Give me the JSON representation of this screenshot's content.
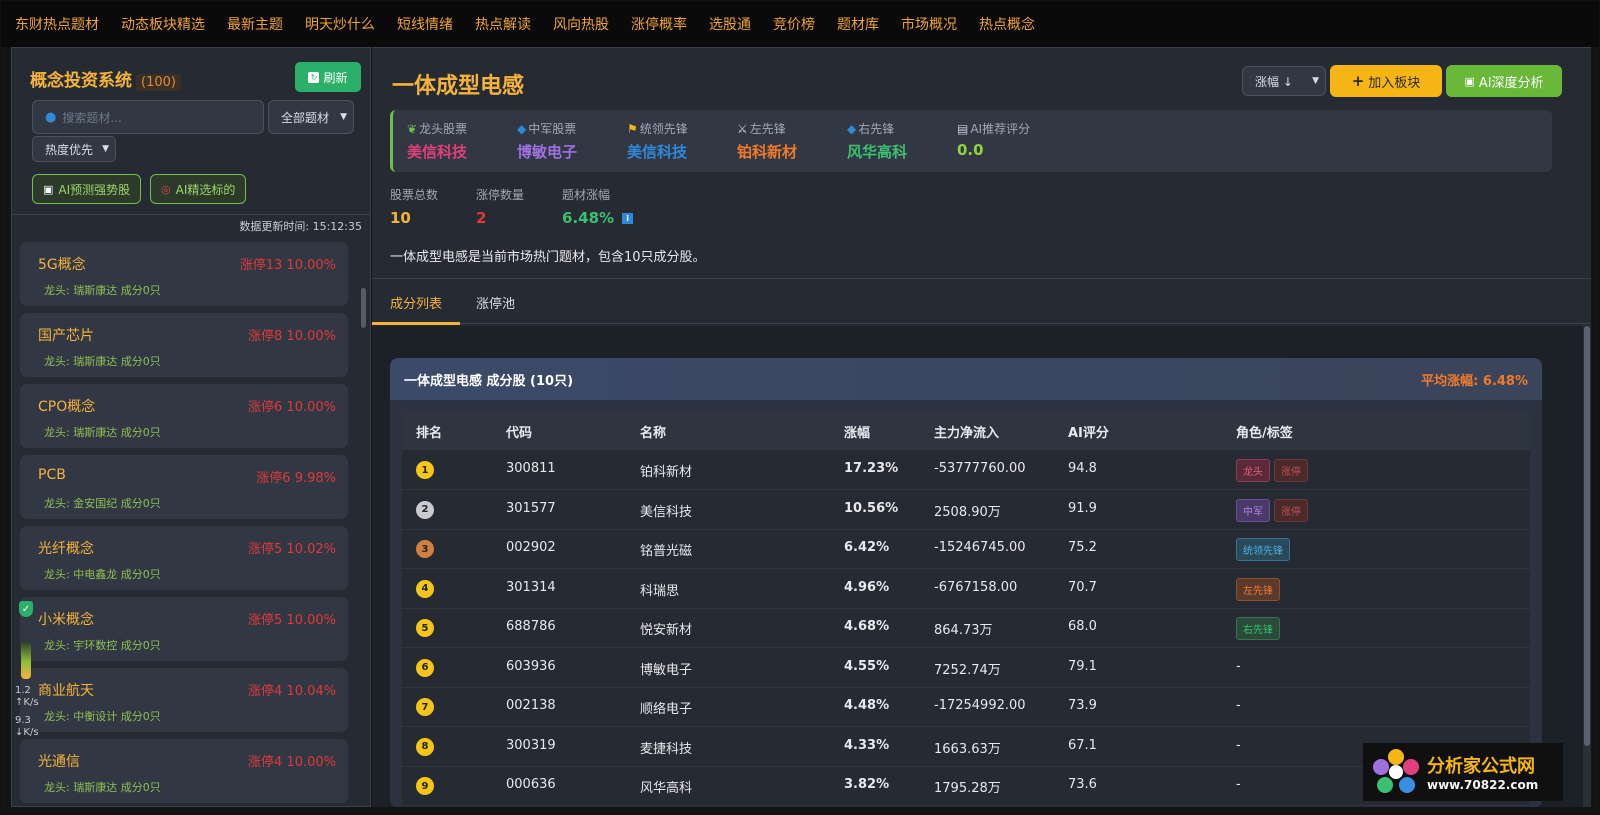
{
  "nav": [
    "东财热点题材",
    "动态板块精选",
    "最新主题",
    "明天炒什么",
    "短线情绪",
    "热点解读",
    "风向热股",
    "涨停概率",
    "选股通",
    "竞价榜",
    "题材库",
    "市场概况",
    "热点概念"
  ],
  "left": {
    "title": "概念投资系统",
    "count": "(100)",
    "refresh": "刷新",
    "search_placeholder": "搜索题材...",
    "filter": "全部题材",
    "sort": "热度优先",
    "ai_predict": "AI预测强势股",
    "ai_select": "AI精选标的",
    "update_time": "数据更新时间: 15:12:35",
    "concepts": [
      {
        "name": "5G概念",
        "stat": "涨停13 10.00%",
        "meta": "龙头: 瑞斯康达   成分0只"
      },
      {
        "name": "国产芯片",
        "stat": "涨停8 10.00%",
        "meta": "龙头: 瑞斯康达   成分0只"
      },
      {
        "name": "CPO概念",
        "stat": "涨停6 10.00%",
        "meta": "龙头: 瑞斯康达   成分0只"
      },
      {
        "name": "PCB",
        "stat": "涨停6 9.98%",
        "meta": "龙头: 金安国纪   成分0只"
      },
      {
        "name": "光纤概念",
        "stat": "涨停5 10.02%",
        "meta": "龙头: 中电鑫龙   成分0只"
      },
      {
        "name": "小米概念",
        "stat": "涨停5 10.00%",
        "meta": "龙头: 宇环数控   成分0只"
      },
      {
        "name": "商业航天",
        "stat": "涨停4 10.04%",
        "meta": "龙头: 中衡设计   成分0只"
      },
      {
        "name": "光通信",
        "stat": "涨停4 10.00%",
        "meta": "龙头: 瑞斯康达   成分0只"
      }
    ]
  },
  "widget": {
    "up": "1.2",
    "up_unit": "K/s",
    "down": "9.3",
    "down_unit": "K/s"
  },
  "main": {
    "title": "一体成型电感",
    "sort": "涨幅 ↓",
    "add": "加入板块",
    "ai": "AI深度分析",
    "roles": [
      {
        "label": "龙头股票",
        "value": "美信科技",
        "color": "#e0407a"
      },
      {
        "label": "中军股票",
        "value": "博敏电子",
        "color": "#a070e0"
      },
      {
        "label": "统领先锋",
        "value": "美信科技",
        "color": "#2e8ad8"
      },
      {
        "label": "左先锋",
        "value": "铂科新材",
        "color": "#f07a2a"
      },
      {
        "label": "右先锋",
        "value": "风华高科",
        "color": "#3ac070"
      },
      {
        "label": "AI推荐评分",
        "value": "0.0",
        "color": "#8fd43a"
      }
    ],
    "stats": [
      {
        "label": "股票总数",
        "value": "10",
        "color": "#f5b33a"
      },
      {
        "label": "涨停数量",
        "value": "2",
        "color": "#e0383a"
      },
      {
        "label": "题材涨幅",
        "value": "6.48%",
        "color": "#3ac070"
      }
    ],
    "description": "一体成型电感是当前市场热门题材，包含10只成分股。",
    "tabs": [
      "成分列表",
      "涨停池"
    ],
    "card_title": "一体成型电感 成分股 (10只)",
    "card_avg": "平均涨幅: 6.48%",
    "columns": [
      "排名",
      "代码",
      "名称",
      "涨幅",
      "主力净流入",
      "AI评分",
      "角色/标签"
    ],
    "rows": [
      {
        "rank": "1",
        "code": "300811",
        "name": "铂科新材",
        "chg": "17.23%",
        "flow": "-53777760.00",
        "ai": "94.8",
        "tags": [
          "龙头",
          "涨停"
        ]
      },
      {
        "rank": "2",
        "code": "301577",
        "name": "美信科技",
        "chg": "10.56%",
        "flow": "2508.90万",
        "ai": "91.9",
        "tags": [
          "中军",
          "涨停"
        ]
      },
      {
        "rank": "3",
        "code": "002902",
        "name": "铭普光磁",
        "chg": "6.42%",
        "flow": "-15246745.00",
        "ai": "75.2",
        "tags": [
          "统领先锋"
        ]
      },
      {
        "rank": "4",
        "code": "301314",
        "name": "科瑞思",
        "chg": "4.96%",
        "flow": "-6767158.00",
        "ai": "70.7",
        "tags": [
          "左先锋"
        ]
      },
      {
        "rank": "5",
        "code": "688786",
        "name": "悦安新材",
        "chg": "4.68%",
        "flow": "864.73万",
        "ai": "68.0",
        "tags": [
          "右先锋"
        ]
      },
      {
        "rank": "6",
        "code": "603936",
        "name": "博敏电子",
        "chg": "4.55%",
        "flow": "7252.74万",
        "ai": "79.1",
        "tags": [
          "-"
        ]
      },
      {
        "rank": "7",
        "code": "002138",
        "name": "顺络电子",
        "chg": "4.48%",
        "flow": "-17254992.00",
        "ai": "73.9",
        "tags": [
          "-"
        ]
      },
      {
        "rank": "8",
        "code": "300319",
        "name": "麦捷科技",
        "chg": "4.33%",
        "flow": "1663.63万",
        "ai": "67.1",
        "tags": [
          "-"
        ]
      },
      {
        "rank": "9",
        "code": "000636",
        "name": "风华高科",
        "chg": "3.82%",
        "flow": "1795.28万",
        "ai": "73.6",
        "tags": [
          "-"
        ]
      }
    ]
  },
  "watermark": {
    "brand": "分析家公式网",
    "url": "www.70822.com"
  }
}
